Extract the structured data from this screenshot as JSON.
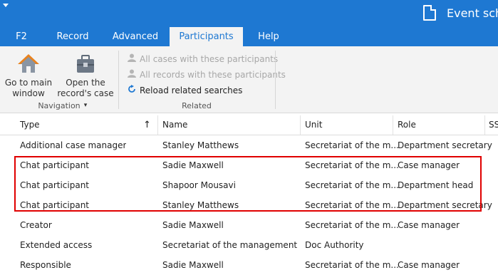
{
  "window": {
    "title": "Event sche"
  },
  "tabs": [
    "F2",
    "Record",
    "Advanced",
    "Participants",
    "Help"
  ],
  "ribbon": {
    "navigation": {
      "go_main_line1": "Go to main",
      "go_main_line2": "window",
      "open_case_line1": "Open the",
      "open_case_line2": "record's case",
      "open_case_caret": "▾",
      "group_label": "Navigation"
    },
    "related": {
      "all_cases": "All cases with these participants",
      "all_records": "All records with these participants",
      "reload": "Reload related searches",
      "group_label": "Related"
    }
  },
  "grid": {
    "columns": [
      "Type",
      "Name",
      "Unit",
      "Role",
      "SS"
    ],
    "sort_indicator": "↑",
    "rows": [
      {
        "type": "Additional case manager",
        "name": "Stanley Matthews",
        "unit": "Secretariat of the m...",
        "role": "Department secretary"
      },
      {
        "type": "Chat participant",
        "name": "Sadie Maxwell",
        "unit": "Secretariat of the m...",
        "role": "Case manager"
      },
      {
        "type": "Chat participant",
        "name": "Shapoor Mousavi",
        "unit": "Secretariat of the m...",
        "role": "Department head"
      },
      {
        "type": "Chat participant",
        "name": "Stanley Matthews",
        "unit": "Secretariat of the m...",
        "role": "Department secretary"
      },
      {
        "type": "Creator",
        "name": "Sadie Maxwell",
        "unit": "Secretariat of the m...",
        "role": "Case manager"
      },
      {
        "type": "Extended access",
        "name": "Secretariat of the management",
        "unit": "Doc Authority",
        "role": ""
      },
      {
        "type": "Responsible",
        "name": "Sadie Maxwell",
        "unit": "Secretariat of the m...",
        "role": "Case manager"
      }
    ]
  },
  "colors": {
    "accent": "#1e78d2",
    "highlight": "#e00000"
  }
}
